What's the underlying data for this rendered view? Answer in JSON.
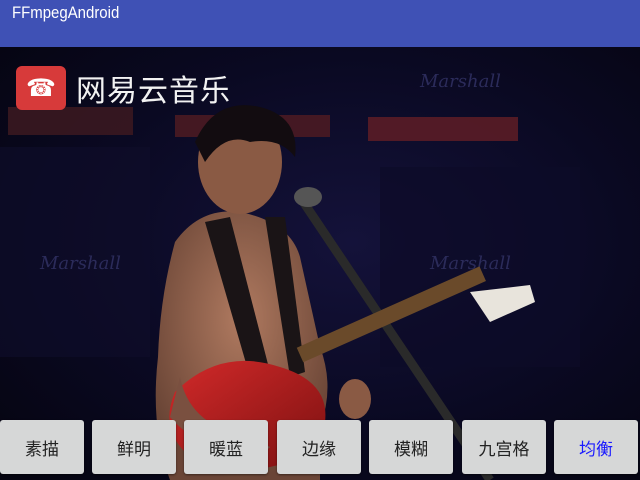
{
  "app_bar": {
    "title": "FFmpegAndroid",
    "color": "#3f51b5"
  },
  "video": {
    "watermark": {
      "icon": "netease-music-logo",
      "text": "网易云音乐"
    }
  },
  "filters": {
    "active_color": "#1a1aff",
    "buttons": [
      {
        "label": "素描"
      },
      {
        "label": "鲜明"
      },
      {
        "label": "暖蓝"
      },
      {
        "label": "边缘"
      },
      {
        "label": "模糊"
      },
      {
        "label": "九宫格"
      },
      {
        "label": "均衡",
        "selected": true
      }
    ]
  }
}
